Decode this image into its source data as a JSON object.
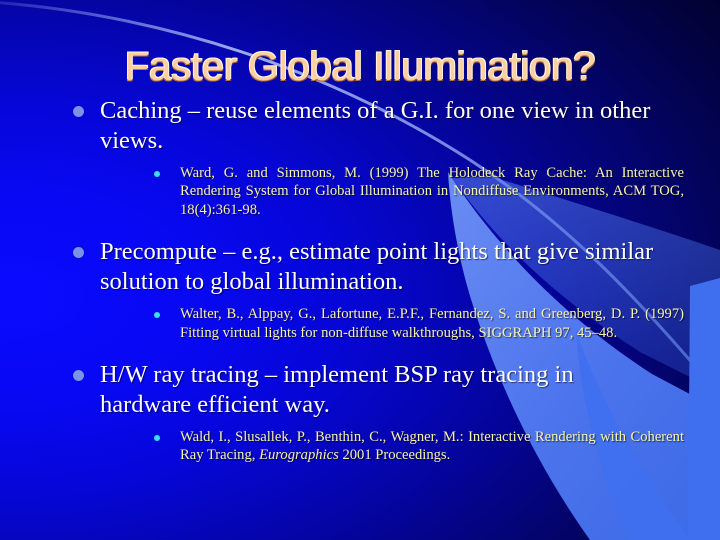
{
  "slide": {
    "title": "Faster Global Illumination?",
    "title_color": "#FBCFA0",
    "body_color": "#FFFFFF",
    "citation_color": "#F7F2B0",
    "bullet_l1_color": "#7A93E8",
    "bullet_l2_color": "#39E0F0",
    "background_left_color": "#0000FF",
    "background_right_color": "#000005",
    "accent_shape_color": "#3F6FEF",
    "bullets": [
      {
        "text": "Caching – reuse elements of a G.I. for one view in other views.",
        "citations": [
          {
            "pre": "Ward, G. and Simmons, M. (1999) The Holodeck Ray Cache: An Interactive Rendering System for Global Illumination in Nondiffuse Environments, ACM TOG, 18(4):361-98.",
            "italic": "",
            "post": ""
          }
        ]
      },
      {
        "text": "Precompute – e.g., estimate point lights that give similar solution to global illumination.",
        "citations": [
          {
            "pre": "Walter, B., Alppay, G., Lafortune, E.P.F., Fernandez, S. and Greenberg, D. P. (1997) Fitting virtual lights for non-diffuse walkthroughs, SIGGRAPH 97, 45–48.",
            "italic": "",
            "post": ""
          }
        ]
      },
      {
        "text": "H/W ray tracing – implement BSP ray tracing in hardware efficient way.",
        "citations": [
          {
            "pre": "Wald, I., Slusallek, P., Benthin, C., Wagner, M.: Interactive Rendering with Coherent Ray Tracing, ",
            "italic": "Eurographics",
            "post": " 2001 Proceedings."
          }
        ]
      }
    ]
  }
}
